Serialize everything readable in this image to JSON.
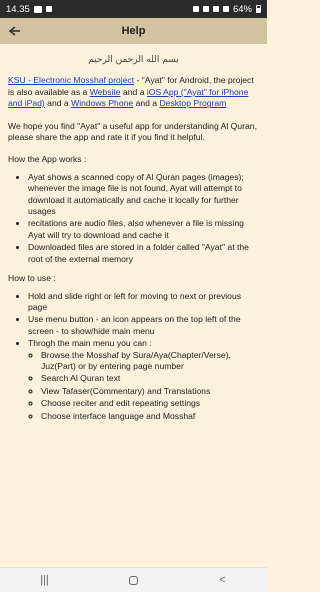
{
  "status_bar": {
    "time": "14.35",
    "battery": "64%"
  },
  "app_bar": {
    "title": "Help",
    "back_icon": "back-arrow-icon"
  },
  "content": {
    "bismillah": "بسم الله الرحمن الرحيم",
    "intro": {
      "link_project": "KSU - Electronic Mosshaf project",
      "text_1": " - \"Ayat\" for Android, the project is also available as a ",
      "link_website": "Website",
      "text_2": " and a ",
      "link_ios": "iOS App (\"Ayat\" for iPhone and iPad)",
      "text_3": " and a ",
      "link_windows": "Windows Phone",
      "text_4": " and a ",
      "link_desktop": "Desktop Program"
    },
    "rate_text": "We hope you find \"Ayat\" a useful app for understanding Al Quran, please share the app and rate it if you find it helpful.",
    "how_works": {
      "title": "How the App works :",
      "items": [
        "Ayat shows a scanned copy of Al Quran pages (images); whenever the image file is not found, Ayat will attempt to download it automatically and cache it locally for further usages",
        "recitations are audio files, also whenever a file is missing Ayat will try to download and cache it",
        "Downloaded files are stored in a folder called \"Ayat\" at the root of the external memory"
      ]
    },
    "how_use": {
      "title": "How to use :",
      "items": [
        "Hold and slide right or left for moving to next or previous page",
        "Use menu button - an icon appears on the top left of the screen - to show/hide main menu",
        "Throgh the main menu you can :"
      ],
      "sub_items": [
        "Browse the Mosshaf by Sura/Aya(Chapter/Verse), Juz(Part) or by entering page number",
        "Search Al Quran text",
        "View Tafaser(Commentary) and Translations",
        "Choose reciter and edit repeating settings",
        "Choose interface language and Mosshaf"
      ]
    }
  },
  "nav_bar": {
    "recents_glyph": "|||",
    "home_glyph": "",
    "back_glyph": "<"
  }
}
